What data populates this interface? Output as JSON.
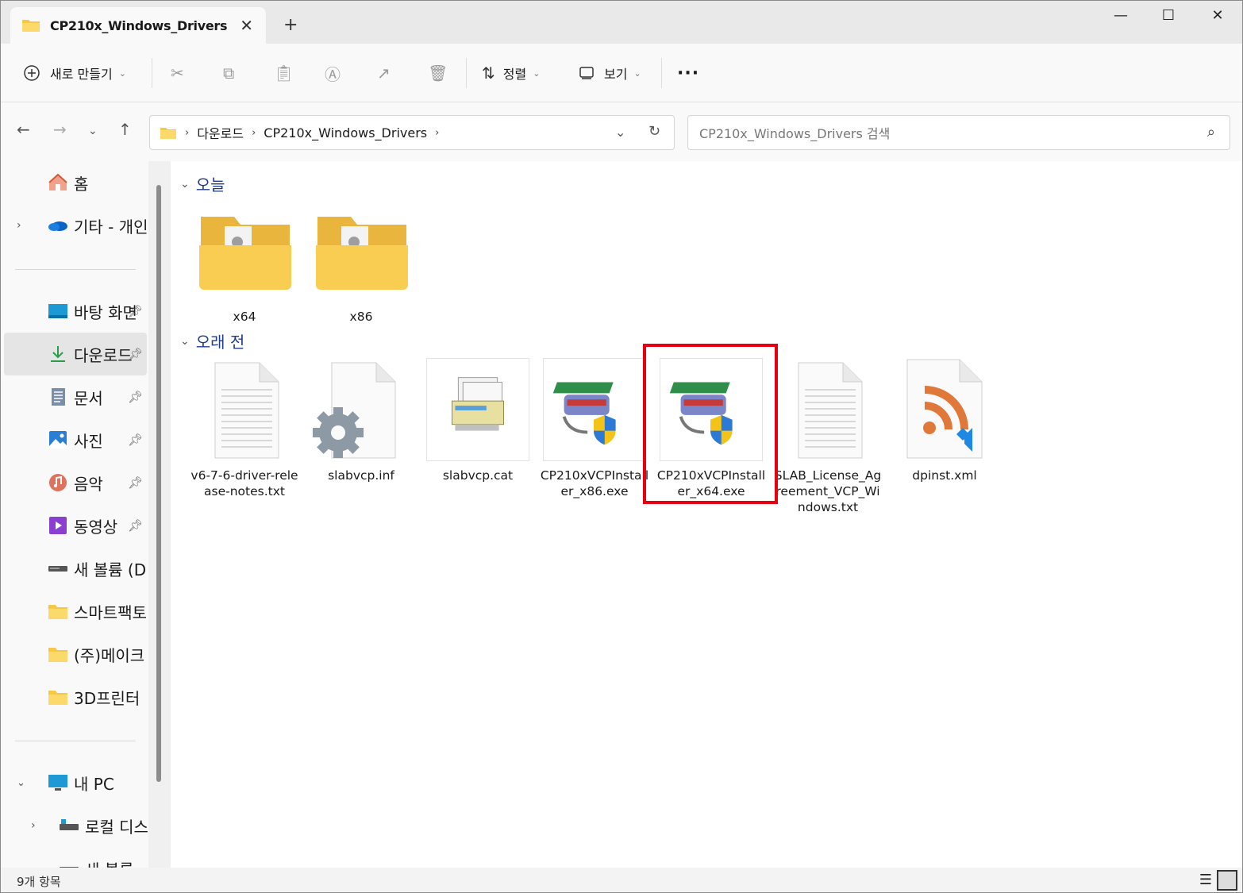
{
  "window": {
    "tab_title": "CP210x_Windows_Drivers",
    "tab_close": "✕",
    "new_tab": "+",
    "minimize": "—",
    "maximize": "☐",
    "close": "✕"
  },
  "toolbar": {
    "new_label": "새로 만들기",
    "sort_label": "정렬",
    "view_label": "보기",
    "more_label": "···"
  },
  "nav": {
    "breadcrumb": [
      "다운로드",
      "CP210x_Windows_Drivers"
    ],
    "search_placeholder": "CP210x_Windows_Drivers 검색"
  },
  "sidebar": {
    "items": [
      {
        "label": "홈"
      },
      {
        "label": "기타 - 개인"
      },
      {
        "label": "바탕 화면"
      },
      {
        "label": "다운로드"
      },
      {
        "label": "문서"
      },
      {
        "label": "사진"
      },
      {
        "label": "음악"
      },
      {
        "label": "동영상"
      },
      {
        "label": "새 볼륨 (D:)"
      },
      {
        "label": "스마트팩토리"
      },
      {
        "label": "(주)메이크"
      },
      {
        "label": "3D프린터"
      },
      {
        "label": "내 PC"
      },
      {
        "label": "로컬 디스크"
      },
      {
        "label": "새 볼륨"
      }
    ]
  },
  "groups": {
    "today": "오늘",
    "earlier": "오래 전"
  },
  "files_today": [
    {
      "name": "x64"
    },
    {
      "name": "x86"
    }
  ],
  "files_earlier": [
    {
      "name": "v6-7-6-driver-release-notes.txt"
    },
    {
      "name": "slabvcp.inf"
    },
    {
      "name": "slabvcp.cat"
    },
    {
      "name": "CP210xVCPInstaller_x86.exe"
    },
    {
      "name": "CP210xVCPInstaller_x64.exe"
    },
    {
      "name": "SLAB_License_Agreement_VCP_Windows.txt"
    },
    {
      "name": "dpinst.xml"
    }
  ],
  "status": {
    "count": "9개 항목"
  },
  "colors": {
    "highlight": "#e60012",
    "folder": "#f7c844",
    "accent": "#1f3c8a"
  }
}
